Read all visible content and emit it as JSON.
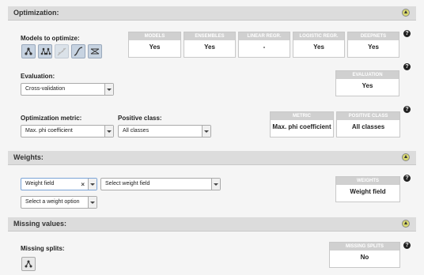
{
  "optimization": {
    "title": "Optimization:",
    "models_label": "Models to optimize:",
    "models_icons": [
      "decision-tree-icon",
      "random-forest-icon",
      "linear-regression-icon",
      "logistic-regression-icon",
      "deepnet-icon"
    ],
    "cards": [
      {
        "head": "MODELS",
        "value": "Yes"
      },
      {
        "head": "ENSEMBLES",
        "value": "Yes"
      },
      {
        "head": "LINEAR REGR.",
        "value": "-"
      },
      {
        "head": "LOGISTIC REGR.",
        "value": "Yes"
      },
      {
        "head": "DEEPNETS",
        "value": "Yes"
      }
    ],
    "evaluation_label": "Evaluation:",
    "evaluation_value": "Cross-validation",
    "evaluation_card": {
      "head": "EVALUATION",
      "value": "Yes"
    },
    "metric_label": "Optimization metric:",
    "metric_value": "Max. phi coefficient",
    "positive_label": "Positive class:",
    "positive_value": "All classes",
    "metric_card": {
      "head": "METRIC",
      "value": "Max. phi coefficient"
    },
    "positive_card": {
      "head": "POSITIVE CLASS",
      "value": "All classes"
    }
  },
  "weights": {
    "title": "Weights:",
    "weight_type_value": "Weight field",
    "weight_type_clear": "×",
    "weight_field_value": "Select weight field",
    "weight_option_value": "Select a weight option",
    "card": {
      "head": "WEIGHTS",
      "value": "Weight field"
    }
  },
  "missing": {
    "title": "Missing values:",
    "splits_label": "Missing splits:",
    "card": {
      "head": "MISSING SPLITS",
      "value": "No"
    }
  },
  "help_glyph": "?"
}
